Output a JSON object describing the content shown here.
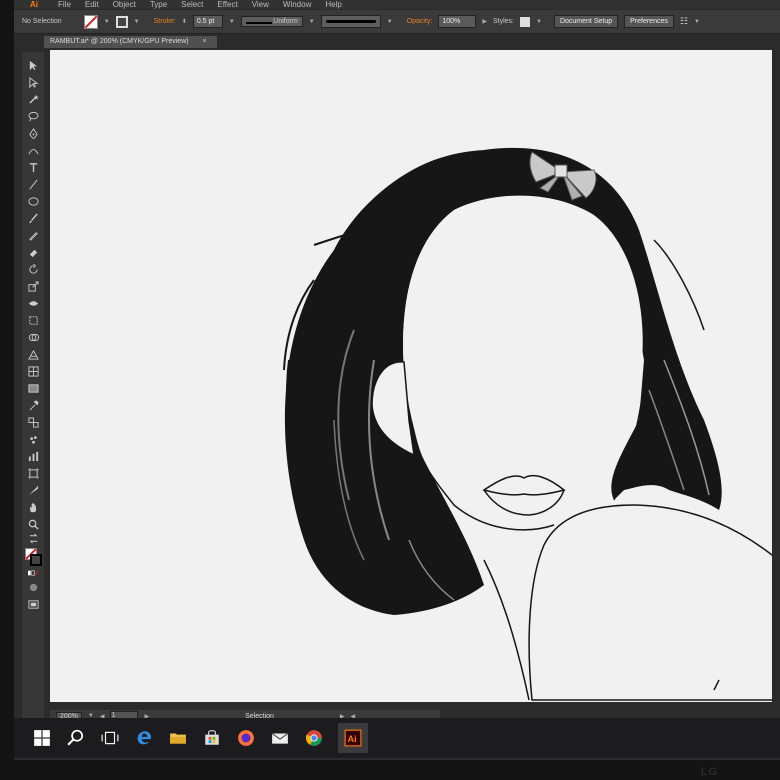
{
  "app": {
    "logo": "Ai",
    "menu": [
      "File",
      "Edit",
      "Object",
      "Type",
      "Select",
      "Effect",
      "View",
      "Window",
      "Help"
    ]
  },
  "control_bar": {
    "selection": "No Selection",
    "stroke_label": "Stroke:",
    "stroke_weight": "0.5 pt",
    "stroke_profile": "Uniform",
    "opacity_label": "Opacity:",
    "opacity_value": "100%",
    "styles_label": "Styles:",
    "document_setup": "Document Setup",
    "preferences": "Preferences"
  },
  "document_tab": {
    "title": "RAMBUT.ai* @ 200% (CMYK/GPU Preview)",
    "close": "×"
  },
  "status_bar": {
    "zoom": "200%",
    "page": "1",
    "tool": "Selection"
  },
  "taskbar": {
    "items": [
      "windows-start",
      "search",
      "task-view",
      "edge",
      "file-explorer",
      "store",
      "firefox",
      "mail",
      "chrome",
      "illustrator"
    ],
    "active": "illustrator",
    "ai_label": "Ai"
  },
  "monitor": {
    "brand": "LG"
  },
  "colors": {
    "accent": "#ff7c00",
    "canvas": "#f1f1f1",
    "hair": "#161616",
    "ui_dark": "#2b2b2b"
  }
}
